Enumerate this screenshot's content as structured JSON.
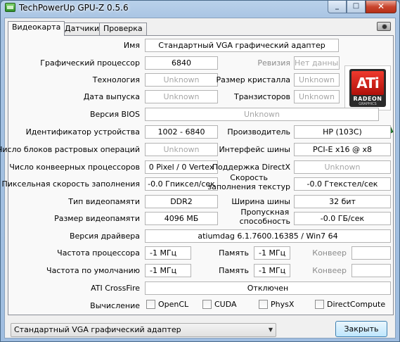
{
  "window": {
    "title": "TechPowerUp GPU-Z 0.5.6",
    "minimize": "_",
    "maximize": "□",
    "close": "✕"
  },
  "tabs": [
    {
      "label": "Видеокарта",
      "active": true
    },
    {
      "label": "Датчики",
      "active": false
    },
    {
      "label": "Проверка",
      "active": false
    }
  ],
  "logo": {
    "brand": "ATi",
    "line": "RADEON",
    "sub": "GRAPHICS"
  },
  "fields": {
    "name": {
      "label": "Имя",
      "value": "Стандартный VGA графический адаптер"
    },
    "gpu": {
      "label": "Графический процессор",
      "value": "6840"
    },
    "revision": {
      "label": "Ревизия",
      "value": "Нет данных"
    },
    "technology": {
      "label": "Технология",
      "value": "Unknown"
    },
    "die_size": {
      "label": "Размер кристалла",
      "value": "Unknown"
    },
    "release_date": {
      "label": "Дата выпуска",
      "value": "Unknown"
    },
    "transistors": {
      "label": "Транзисторов",
      "value": "Unknown"
    },
    "bios": {
      "label": "Версия BIOS",
      "value": "Unknown"
    },
    "device_id": {
      "label": "Идентификатор устройства",
      "value": "1002 - 6840"
    },
    "vendor": {
      "label": "Производитель",
      "value": "HP (103C)"
    },
    "rops": {
      "label": "Число блоков растровых операций",
      "value": "Unknown"
    },
    "bus": {
      "label": "Интерфейс шины",
      "value": "PCI-E x16 @ x8"
    },
    "shaders": {
      "label": "Число конвеерных процессоров",
      "value": "0 Pixel / 0 Vertex"
    },
    "directx": {
      "label": "Поддержка DirectX",
      "value": "Unknown"
    },
    "pixel_fill": {
      "label": "Пиксельная скорость заполнения",
      "value": "-0.0 Гпиксел/сек"
    },
    "texture_fill": {
      "label_line1": "Скорость",
      "label_line2": "заполнения текстур",
      "value": "-0.0 Гтекстел/сек"
    },
    "mem_type": {
      "label": "Тип видеопамяти",
      "value": "DDR2"
    },
    "bus_width": {
      "label": "Ширина шины",
      "value": "32 бит"
    },
    "mem_size": {
      "label": "Размер видеопамяти",
      "value": "4096 МБ"
    },
    "bandwidth": {
      "label_line1": "Пропускная",
      "label_line2": "способность",
      "value": "-0.0 ГБ/сек"
    },
    "driver": {
      "label": "Версия драйвера",
      "value": "atiumdag 6.1.7600.16385 / Win7 64"
    },
    "gpu_clock": {
      "label": "Частота процессора",
      "value": "-1 МГц"
    },
    "mem_clock": {
      "label": "Память",
      "value": "-1 МГц"
    },
    "shader_clock": {
      "label": "Конвеер",
      "value": ""
    },
    "default_clock": {
      "label": "Частота по умолчанию",
      "value": "-1 МГц"
    },
    "default_mem": {
      "label": "Память",
      "value": "-1 МГц"
    },
    "default_shader": {
      "label": "Конвеер",
      "value": ""
    },
    "crossfire": {
      "label": "ATI CrossFire",
      "value": "Отключен"
    },
    "compute": {
      "label": "Вычисление"
    }
  },
  "compute_options": [
    {
      "label": "OpenCL",
      "checked": false
    },
    {
      "label": "CUDA",
      "checked": false
    },
    {
      "label": "PhysX",
      "checked": false
    },
    {
      "label": "DirectCompute",
      "checked": false
    }
  ],
  "footer": {
    "selected_adapter": "Стандартный VGA графический адаптер",
    "dropdown_arrow": "▼",
    "close_label": "Закрыть"
  }
}
